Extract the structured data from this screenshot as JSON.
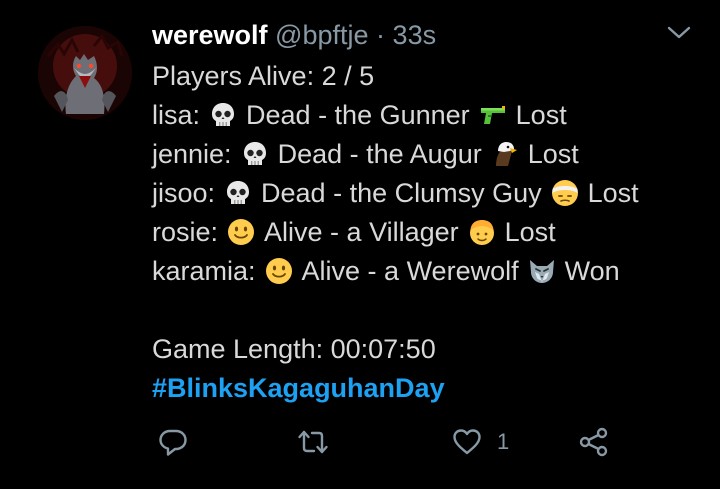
{
  "tweet": {
    "author_name": "werewolf",
    "handle": "@bpftje",
    "separator": "·",
    "time": "33s",
    "lines": [
      {
        "text": "Players Alive: 2 / 5"
      },
      {
        "name": "lisa:",
        "status": "Dead - the Gunner",
        "result": "Lost",
        "status_icon": "skull-icon",
        "role_icon": "water-pistol-icon"
      },
      {
        "name": "jennie:",
        "status": "Dead - the Augur",
        "result": "Lost",
        "status_icon": "skull-icon",
        "role_icon": "eagle-icon"
      },
      {
        "name": "jisoo:",
        "status": "Dead - the Clumsy Guy",
        "result": "Lost",
        "status_icon": "skull-icon",
        "role_icon": "bandaged-face-icon"
      },
      {
        "name": "rosie:",
        "status": "Alive - a Villager",
        "result": "Lost",
        "status_icon": "smiley-icon",
        "role_icon": "person-icon"
      },
      {
        "name": "karamia:",
        "status": "Alive - a Werewolf",
        "result": "Won",
        "status_icon": "smiley-icon",
        "role_icon": "wolf-icon"
      }
    ],
    "game_length": "Game Length: 00:07:50",
    "hashtag": "#BlinksKagaguhanDay"
  },
  "actions": {
    "like_count": "1",
    "reply_icon": "reply-icon",
    "retweet_icon": "retweet-icon",
    "like_icon": "heart-icon",
    "share_icon": "share-icon"
  },
  "colors": {
    "background": "#000000",
    "text": "#d9d9d9",
    "muted": "#8899a6",
    "link": "#1da1f2"
  }
}
